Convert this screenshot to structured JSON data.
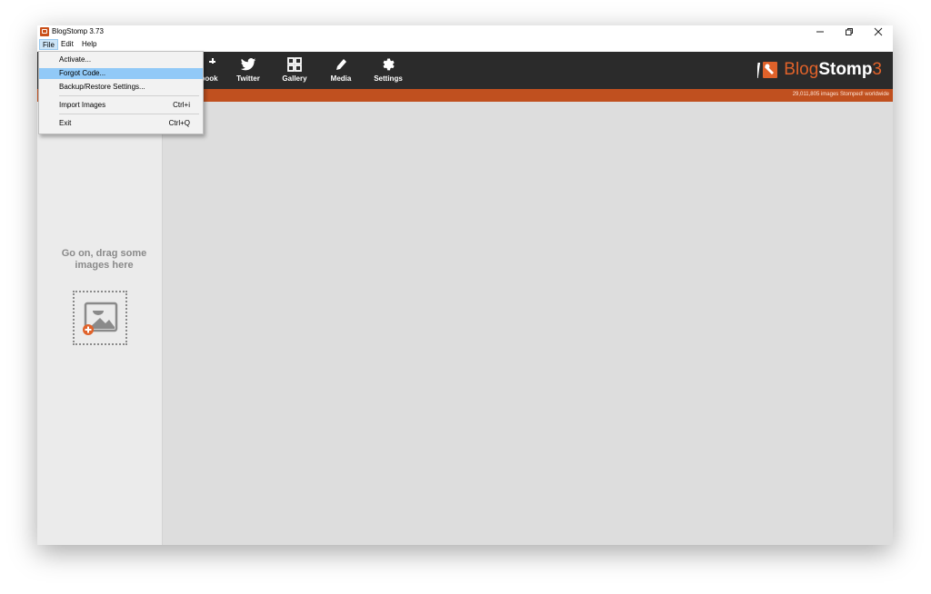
{
  "window": {
    "title": "BlogStomp 3.73",
    "controls": [
      "minimize",
      "restore",
      "close"
    ]
  },
  "menubar": {
    "items": [
      {
        "label": "File",
        "active": true
      },
      {
        "label": "Edit",
        "active": false
      },
      {
        "label": "Help",
        "active": false
      }
    ]
  },
  "file_menu": {
    "items": [
      {
        "label": "Activate...",
        "shortcut": "",
        "highlighted": false
      },
      {
        "label": "Forgot Code...",
        "shortcut": "",
        "highlighted": true
      },
      {
        "label": "Backup/Restore Settings...",
        "shortcut": "",
        "highlighted": false
      },
      {
        "label": "Import Images",
        "shortcut": "Ctrl+i",
        "highlighted": false
      },
      {
        "label": "Exit",
        "shortcut": "Ctrl+Q",
        "highlighted": false
      }
    ]
  },
  "toolbar": {
    "items": [
      {
        "label": "book",
        "icon": "facebook-icon"
      },
      {
        "label": "Twitter",
        "icon": "twitter-icon"
      },
      {
        "label": "Gallery",
        "icon": "gallery-icon"
      },
      {
        "label": "Media",
        "icon": "pencil-icon"
      },
      {
        "label": "Settings",
        "icon": "gear-icon"
      }
    ],
    "brand": {
      "part1": "Blog",
      "part2": "Stomp",
      "part3": "3"
    }
  },
  "status": {
    "stomped_text": "29,011,805 images Stomped! worldwide"
  },
  "left_panel": {
    "drop_text_line1": "Go on, drag some",
    "drop_text_line2": "images here",
    "bottom_icons": [
      "add-icon",
      "remove-icon",
      "grid-view-icon",
      "list-view-icon"
    ]
  },
  "colors": {
    "accent": "#c0501f",
    "brand_orange": "#e0622a",
    "toolbar_bg": "#2b2b2b",
    "menu_highlight": "#91c9f7"
  }
}
